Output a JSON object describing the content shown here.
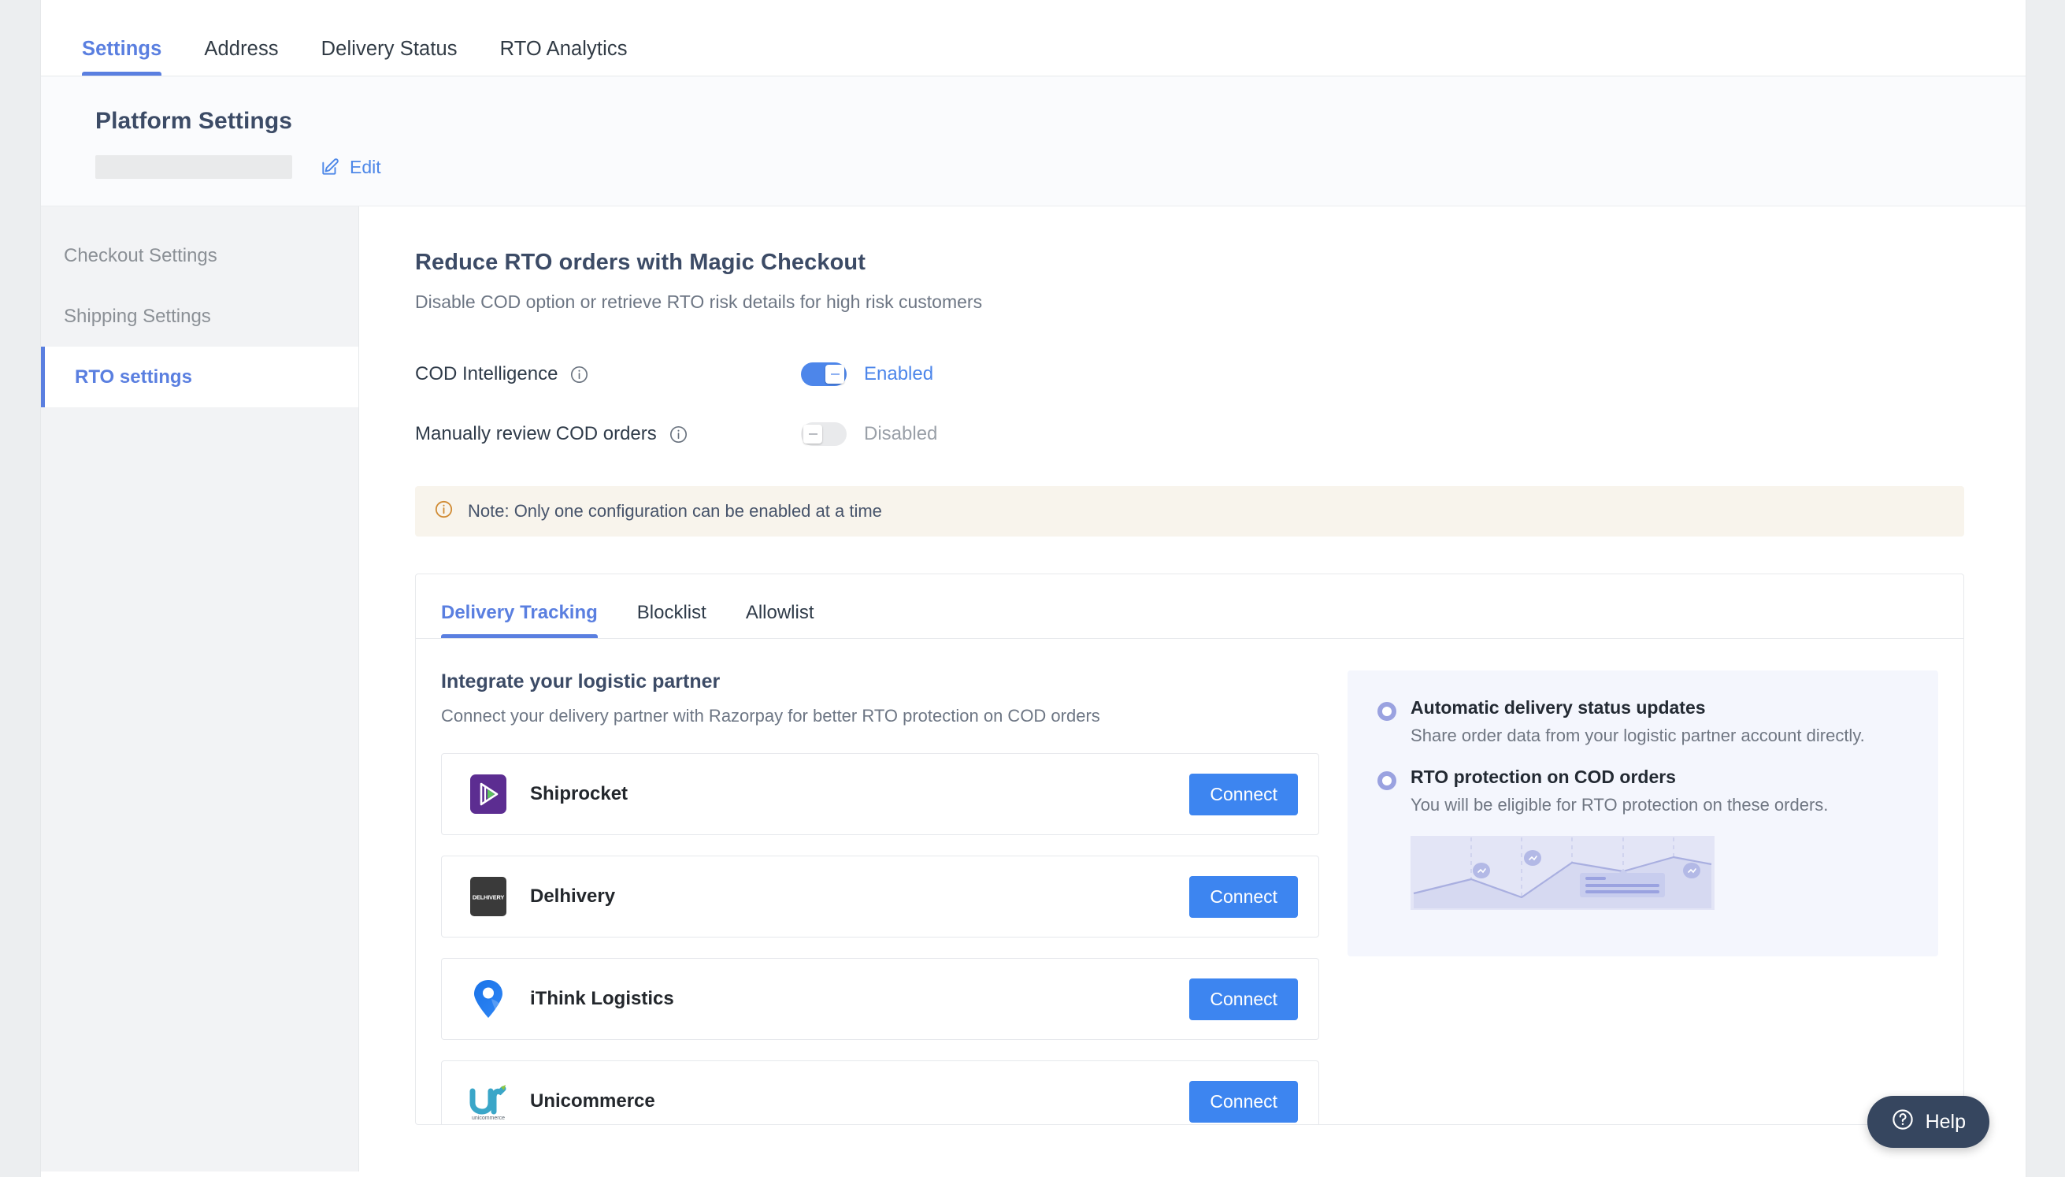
{
  "top_tabs": [
    {
      "label": "Settings",
      "active": true
    },
    {
      "label": "Address",
      "active": false
    },
    {
      "label": "Delivery Status",
      "active": false
    },
    {
      "label": "RTO Analytics",
      "active": false
    }
  ],
  "header": {
    "title": "Platform Settings",
    "edit_label": "Edit"
  },
  "sidebar": {
    "items": [
      {
        "label": "Checkout Settings",
        "active": false
      },
      {
        "label": "Shipping Settings",
        "active": false
      },
      {
        "label": "RTO settings",
        "active": true
      }
    ]
  },
  "main": {
    "title": "Reduce RTO orders with Magic Checkout",
    "subtitle": "Disable COD option or retrieve RTO risk details for high risk customers",
    "settings": [
      {
        "label": "COD Intelligence",
        "state_label": "Enabled",
        "enabled": true
      },
      {
        "label": "Manually review COD orders",
        "state_label": "Disabled",
        "enabled": false
      }
    ],
    "note": "Note: Only one configuration can be enabled at a time",
    "tabs": [
      {
        "label": "Delivery Tracking",
        "active": true
      },
      {
        "label": "Blocklist",
        "active": false
      },
      {
        "label": "Allowlist",
        "active": false
      }
    ],
    "integrate": {
      "title": "Integrate your logistic partner",
      "subtitle": "Connect your delivery partner with Razorpay for better RTO protection on COD orders",
      "connect_label": "Connect",
      "partners": [
        {
          "name": "Shiprocket",
          "logo": "shiprocket-logo"
        },
        {
          "name": "Delhivery",
          "logo": "delhivery-logo",
          "logo_text": "DELHIVERY"
        },
        {
          "name": "iThink Logistics",
          "logo": "ithink-logistics-logo"
        },
        {
          "name": "Unicommerce",
          "logo": "unicommerce-logo",
          "logo_text": "unicommerce"
        }
      ]
    },
    "info_panel": {
      "bullets": [
        {
          "title": "Automatic delivery status updates",
          "text": "Share order data from your logistic partner account directly."
        },
        {
          "title": "RTO protection on COD orders",
          "text": "You will be eligible for RTO protection on these orders."
        }
      ]
    }
  },
  "help": {
    "label": "Help"
  },
  "colors": {
    "accent_blue": "#5a7fe0",
    "button_blue": "#3d85f0",
    "heading_navy": "#3c4b66",
    "note_bg": "#f8f4ec",
    "note_icon": "#d08a32",
    "panel_bg": "#f4f6fd",
    "bullet_ring": "#9aa2e0",
    "help_bg": "#36465f",
    "shiprocket_purple": "#5c2d91",
    "delhivery_dark": "#3a3a3a",
    "ithink_blue": "#1a73e8",
    "unicommerce_teal": "#3aa6c8"
  }
}
